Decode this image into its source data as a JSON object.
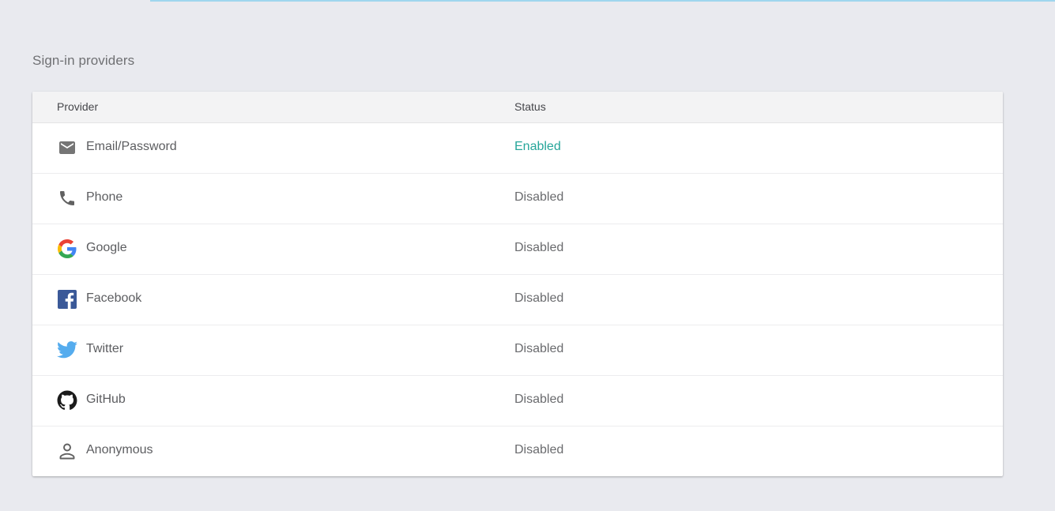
{
  "section": {
    "title": "Sign-in providers"
  },
  "table": {
    "headers": {
      "provider": "Provider",
      "status": "Status"
    },
    "rows": [
      {
        "provider": "Email/Password",
        "status": "Enabled",
        "icon": "mail-icon"
      },
      {
        "provider": "Phone",
        "status": "Disabled",
        "icon": "phone-icon"
      },
      {
        "provider": "Google",
        "status": "Disabled",
        "icon": "google-icon"
      },
      {
        "provider": "Facebook",
        "status": "Disabled",
        "icon": "facebook-icon"
      },
      {
        "provider": "Twitter",
        "status": "Disabled",
        "icon": "twitter-icon"
      },
      {
        "provider": "GitHub",
        "status": "Disabled",
        "icon": "github-icon"
      },
      {
        "provider": "Anonymous",
        "status": "Disabled",
        "icon": "person-icon"
      }
    ]
  },
  "colors": {
    "enabled": "#26a69a",
    "background": "#e9eaef",
    "accent_strip": "#9fd6ee"
  }
}
